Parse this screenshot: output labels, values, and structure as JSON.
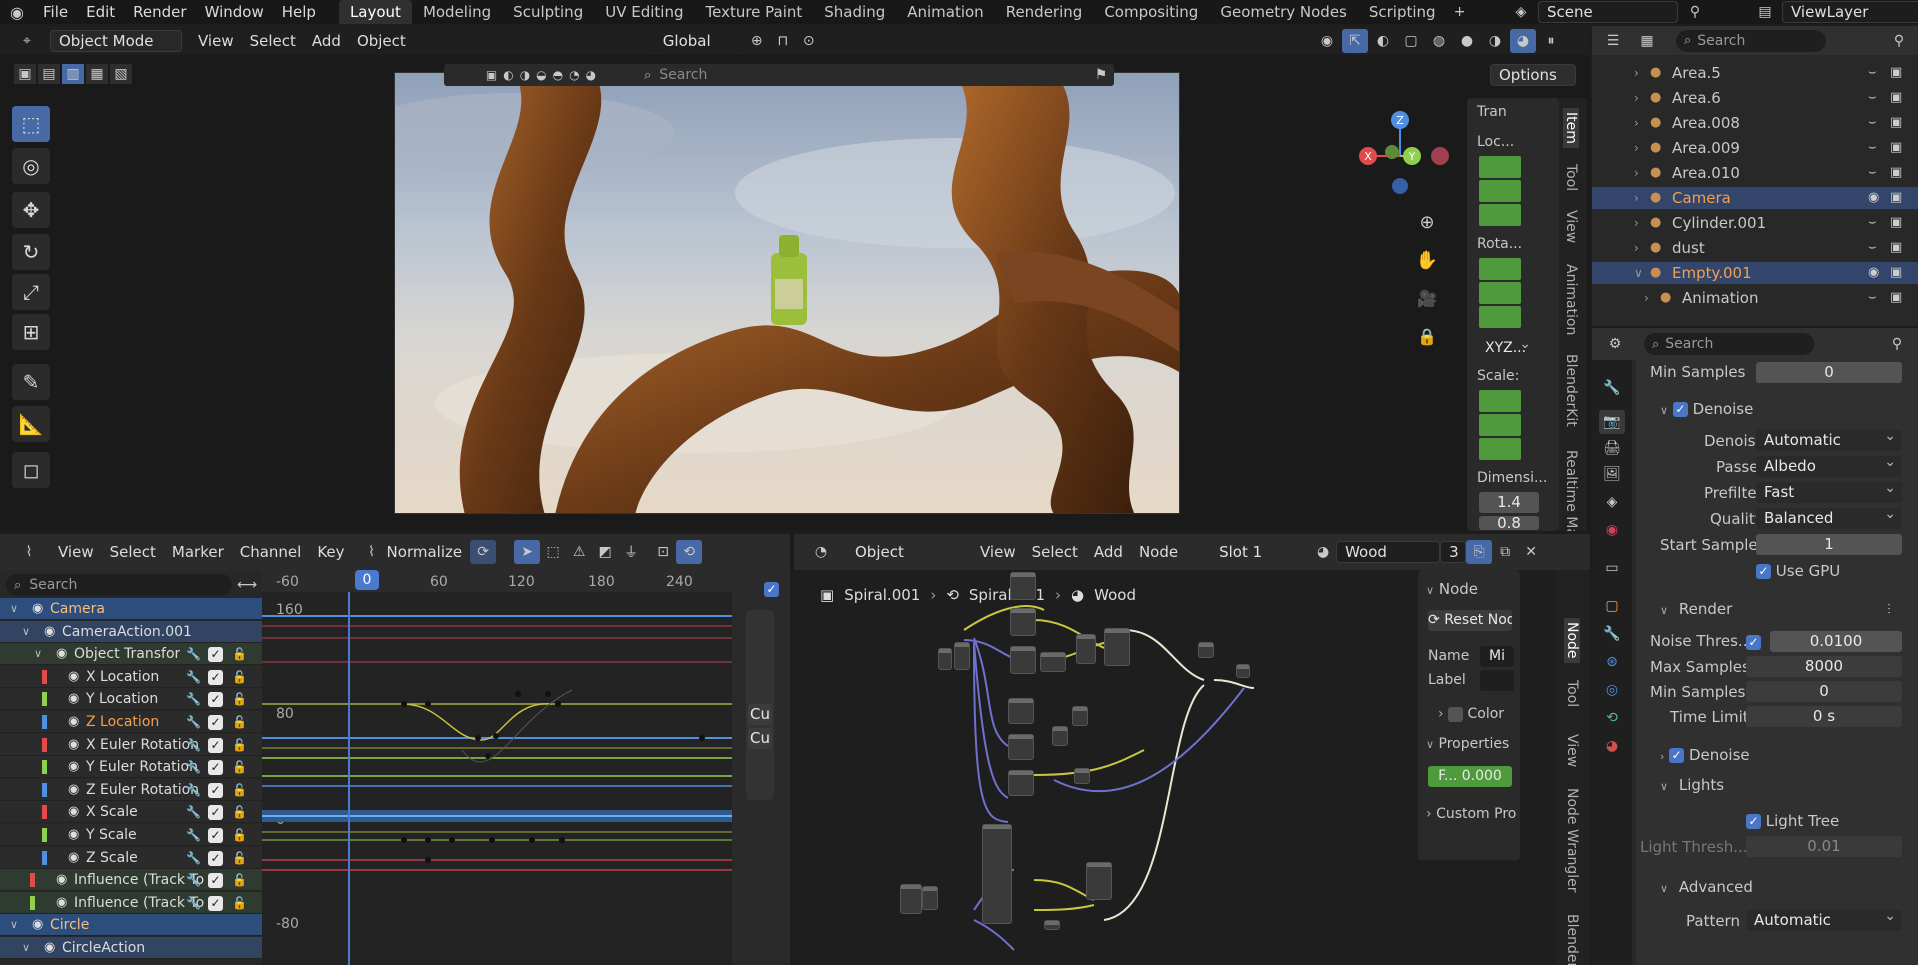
{
  "menu": [
    "File",
    "Edit",
    "Render",
    "Window",
    "Help"
  ],
  "workspaces": [
    "Layout",
    "Modeling",
    "Sculpting",
    "UV Editing",
    "Texture Paint",
    "Shading",
    "Animation",
    "Rendering",
    "Compositing",
    "Geometry Nodes",
    "Scripting"
  ],
  "scene": "Scene",
  "view_layer": "ViewLayer",
  "viewport": {
    "mode": "Object Mode",
    "menus": [
      "View",
      "Select",
      "Add",
      "Object"
    ],
    "orientation": "Global",
    "search_placeholder": "Search",
    "options": "Options",
    "side_tabs": [
      "Item",
      "Tool",
      "View",
      "Animation",
      "BlenderKit",
      "Realtime Ma"
    ],
    "transform": {
      "header": "Tran",
      "location": "Loc...",
      "rotation": "Rota...",
      "rotation_mode": "XYZ...",
      "scale": "Scale:",
      "dimensions": "Dimensi...",
      "dim1": "1.4",
      "dim2": "0.8"
    },
    "gizmo": {
      "x": "X",
      "y": "Y",
      "z": "Z"
    }
  },
  "outliner": {
    "search_placeholder": "Search",
    "items": [
      {
        "name": "Area.5",
        "color": "#c8c8c8"
      },
      {
        "name": "Area.6",
        "color": "#c8c8c8"
      },
      {
        "name": "Area.008",
        "color": "#c8c8c8"
      },
      {
        "name": "Area.009",
        "color": "#c8c8c8"
      },
      {
        "name": "Area.010",
        "color": "#c8c8c8"
      },
      {
        "name": "Camera",
        "color": "#f0a050"
      },
      {
        "name": "Cylinder.001",
        "color": "#c8c8c8"
      },
      {
        "name": "dust",
        "color": "#c8c8c8"
      },
      {
        "name": "Empty.001",
        "color": "#f0a050"
      },
      {
        "name": "Animation",
        "color": "#c8c8c8"
      }
    ]
  },
  "properties": {
    "search_placeholder": "Search",
    "min_samples_top": {
      "label": "Min Samples",
      "value": "0"
    },
    "denoise1": "Denoise",
    "denoiser": {
      "label": "Denoiser",
      "value": "Automatic"
    },
    "passes": {
      "label": "Passes",
      "value": "Albedo"
    },
    "prefilter": {
      "label": "Prefilter",
      "value": "Fast"
    },
    "quality": {
      "label": "Quality",
      "value": "Balanced"
    },
    "start_sample": {
      "label": "Start Sample",
      "value": "1"
    },
    "use_gpu": "Use GPU",
    "render": "Render",
    "noise_threshold": {
      "label": "Noise Thres...",
      "value": "0.0100"
    },
    "max_samples": {
      "label": "Max Samples",
      "value": "8000"
    },
    "min_samples": {
      "label": "Min Samples",
      "value": "0"
    },
    "time_limit": {
      "label": "Time Limit",
      "value": "0 s"
    },
    "denoise2": "Denoise",
    "lights": "Lights",
    "light_tree": "Light Tree",
    "light_threshold": {
      "label": "Light Thresh...",
      "value": "0.01"
    },
    "advanced": "Advanced",
    "pattern": {
      "label": "Pattern",
      "value": "Automatic"
    }
  },
  "graph": {
    "menus": [
      "View",
      "Select",
      "Marker",
      "Channel",
      "Key"
    ],
    "normalize": "Normalize",
    "search_placeholder": "Search",
    "ruler": [
      "-60",
      "0",
      "60",
      "120",
      "180",
      "240"
    ],
    "yaxis": [
      "160",
      "80",
      "0",
      "-80"
    ],
    "cu1": "Cu",
    "cu2": "Cu",
    "channels": [
      {
        "name": "Camera",
        "color": "",
        "level": 0,
        "selected": true
      },
      {
        "name": "CameraAction.001",
        "color": "",
        "level": 1,
        "selected": false
      },
      {
        "name": "Object Transfor",
        "color": "",
        "level": 2,
        "selected": false
      },
      {
        "name": "X Location",
        "color": "#e04b4b",
        "level": 3,
        "selected": false
      },
      {
        "name": "Y Location",
        "color": "#8fd14f",
        "level": 3,
        "selected": false
      },
      {
        "name": "Z Location",
        "color": "#4f8fe0",
        "level": 3,
        "selected": false,
        "hl": true
      },
      {
        "name": "X Euler Rotation",
        "color": "#e04b4b",
        "level": 3,
        "selected": false
      },
      {
        "name": "Y Euler Rotation",
        "color": "#8fd14f",
        "level": 3,
        "selected": false
      },
      {
        "name": "Z Euler Rotation",
        "color": "#4f8fe0",
        "level": 3,
        "selected": false
      },
      {
        "name": "X Scale",
        "color": "#e04b4b",
        "level": 3,
        "selected": false
      },
      {
        "name": "Y Scale",
        "color": "#8fd14f",
        "level": 3,
        "selected": false
      },
      {
        "name": "Z Scale",
        "color": "#4f8fe0",
        "level": 3,
        "selected": false
      },
      {
        "name": "Influence (Track To",
        "color": "#e04b4b",
        "level": 2,
        "selected": false
      },
      {
        "name": "Influence (Track To",
        "color": "#8fd14f",
        "level": 2,
        "selected": false
      },
      {
        "name": "Circle",
        "color": "",
        "level": 0,
        "selected": true
      },
      {
        "name": "CircleAction",
        "color": "",
        "level": 1,
        "selected": false
      }
    ]
  },
  "node_editor": {
    "type": "Object",
    "menus": [
      "View",
      "Select",
      "Add",
      "Node"
    ],
    "slot": "Slot 1",
    "material": "Wood",
    "users": "3",
    "breadcrumb": [
      "Spiral.001",
      "Spiral.001",
      "Wood"
    ],
    "node_panel": {
      "header": "Node",
      "reset": "Reset Node",
      "name_label": "Name",
      "name_value": "Mi",
      "label_label": "Label",
      "color": "Color",
      "properties": "Properties",
      "prop_value": "F...  0.000",
      "custom": "Custom Pro"
    },
    "side_tabs": [
      "Node",
      "Tool",
      "View",
      "Node Wrangler",
      "BlenderKit"
    ]
  }
}
